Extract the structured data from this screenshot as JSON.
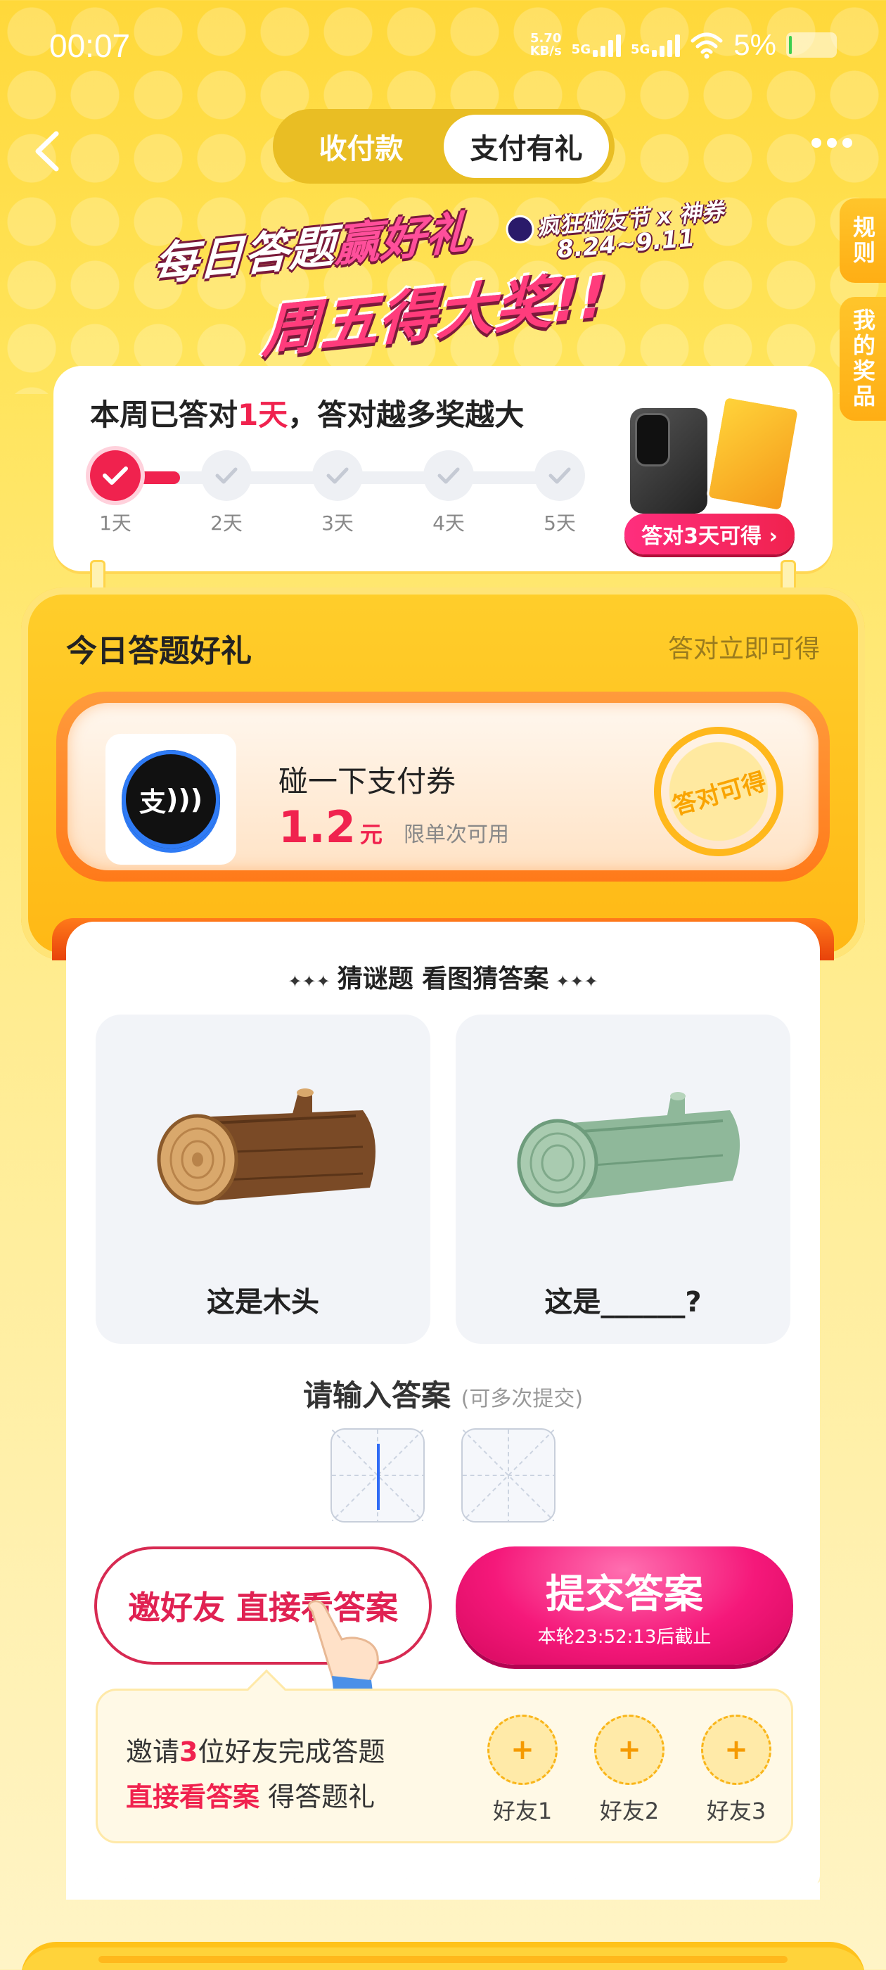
{
  "status_bar": {
    "time": "00:07",
    "net_speed_value": "5.70",
    "net_speed_unit": "KB/s",
    "signal1": "5G",
    "signal2": "5G",
    "battery": "5%"
  },
  "nav": {
    "tabs": [
      {
        "label": "收付款",
        "active": false
      },
      {
        "label": "支付有礼",
        "active": true
      }
    ]
  },
  "side_tabs": {
    "rules": "规则",
    "my_prizes": "我的奖品"
  },
  "banner": {
    "line1_a": "每日答题",
    "line1_b": "赢好礼",
    "line2": "周五得大奖!!",
    "event_name": "疯狂碰友节",
    "event_partner": "x 神券",
    "event_dates": "8.24~9.11"
  },
  "weekly": {
    "title_prefix": "本周已答对",
    "title_days": "1天",
    "title_suffix": "，答对越多奖越大",
    "days": [
      "1天",
      "2天",
      "3天",
      "4天",
      "5天"
    ],
    "completed_days": 1,
    "prize_cta": "答对3天可得 ›"
  },
  "today": {
    "title": "今日答题好礼",
    "subtitle": "答对立即可得",
    "coupon": {
      "icon_text": "支",
      "name": "碰一下支付券",
      "amount": "1.2",
      "unit": "元",
      "limit": "限单次可用",
      "stamp": "答对可得"
    }
  },
  "quiz": {
    "title": "猜谜题 看图猜答案",
    "left_caption": "这是木头",
    "right_caption": "这是______?",
    "answer_label": "请输入答案",
    "answer_hint": "(可多次提交)",
    "char_count": 2,
    "invite_button": "邀好友 直接看答案",
    "submit_button": "提交答案",
    "submit_deadline": "本轮23:52:13后截止"
  },
  "invite": {
    "line1_a": "邀请",
    "line1_num": "3",
    "line1_b": "位好友完成答题",
    "line2_red": "直接看答案",
    "line2_rest": " 得答题礼",
    "friends": [
      {
        "symbol": "+",
        "label": "好友1"
      },
      {
        "symbol": "+",
        "label": "好友2"
      },
      {
        "symbol": "+",
        "label": "好友3"
      }
    ]
  },
  "colors": {
    "accent_red": "#F0224E",
    "accent_pink": "#F5187A",
    "bg_yellow": "#FFD83A"
  }
}
